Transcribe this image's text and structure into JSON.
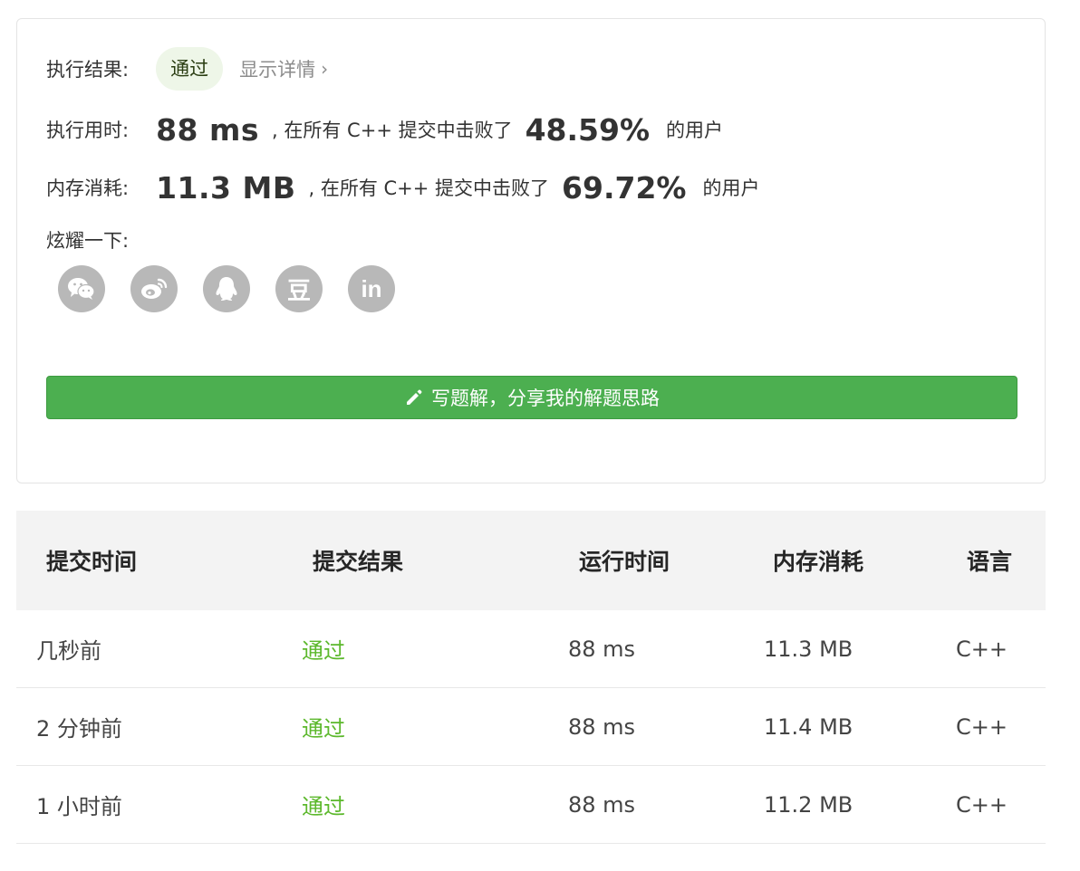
{
  "result": {
    "label": "执行结果:",
    "status": "通过",
    "details_link": "显示详情",
    "chevron": "›"
  },
  "runtime": {
    "label": "执行用时:",
    "value": "88 ms",
    "mid_text": ", 在所有 C++ 提交中击败了",
    "percent": "48.59%",
    "tail_text": "的用户"
  },
  "memory": {
    "label": "内存消耗:",
    "value": "11.3 MB",
    "mid_text": ", 在所有 C++ 提交中击败了",
    "percent": "69.72%",
    "tail_text": "的用户"
  },
  "share": {
    "label": "炫耀一下:",
    "icons": [
      "wechat-icon",
      "weibo-icon",
      "qq-icon",
      "douban-icon",
      "linkedin-icon"
    ],
    "douban_glyph": "豆",
    "linkedin_glyph": "in"
  },
  "write_button": {
    "icon": "pencil-icon",
    "label": "写题解，分享我的解题思路"
  },
  "colors": {
    "success_green": "#5cb82c",
    "button_green": "#4caf50",
    "badge_bg": "#eef6e8",
    "icon_gray": "#b8b8b8"
  },
  "table": {
    "headers": [
      "提交时间",
      "提交结果",
      "运行时间",
      "内存消耗",
      "语言"
    ],
    "rows": [
      {
        "time": "几秒前",
        "result": "通过",
        "runtime": "88 ms",
        "memory": "11.3 MB",
        "language": "C++"
      },
      {
        "time": "2 分钟前",
        "result": "通过",
        "runtime": "88 ms",
        "memory": "11.4 MB",
        "language": "C++"
      },
      {
        "time": "1 小时前",
        "result": "通过",
        "runtime": "88 ms",
        "memory": "11.2 MB",
        "language": "C++"
      }
    ]
  }
}
